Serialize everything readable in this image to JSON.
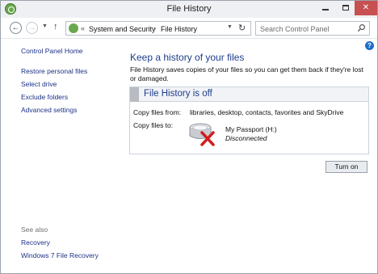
{
  "window": {
    "title": "File History"
  },
  "address_bar": {
    "overflow_chevron": "«",
    "crumbs": [
      "System and Security",
      "File History"
    ],
    "separator": "›"
  },
  "search": {
    "placeholder": "Search Control Panel"
  },
  "sidebar": {
    "home": "Control Panel Home",
    "links": [
      "Restore personal files",
      "Select drive",
      "Exclude folders",
      "Advanced settings"
    ],
    "see_also_label": "See also",
    "see_also": [
      "Recovery",
      "Windows 7 File Recovery"
    ]
  },
  "main": {
    "heading": "Keep a history of your files",
    "description": "File History saves copies of your files so you can get them back if they're lost or damaged.",
    "status_title": "File History is off",
    "copy_from_label": "Copy files from:",
    "copy_from_value": "libraries, desktop, contacts, favorites and SkyDrive",
    "copy_to_label": "Copy files to:",
    "drive_name": "My Passport (H:)",
    "drive_status": "Disconnected",
    "turn_on_button": "Turn on"
  },
  "icons": {
    "app": "file-history-icon",
    "back": "back-arrow-icon",
    "forward": "forward-arrow-icon",
    "up": "up-arrow-icon",
    "refresh": "refresh-icon",
    "search": "magnifier-icon",
    "help": "help-icon",
    "drive": "disconnected-drive-icon"
  },
  "colors": {
    "link": "#1e3287",
    "heading": "#1e3d8c",
    "close_button": "#c75050",
    "error_x": "#d02020"
  }
}
